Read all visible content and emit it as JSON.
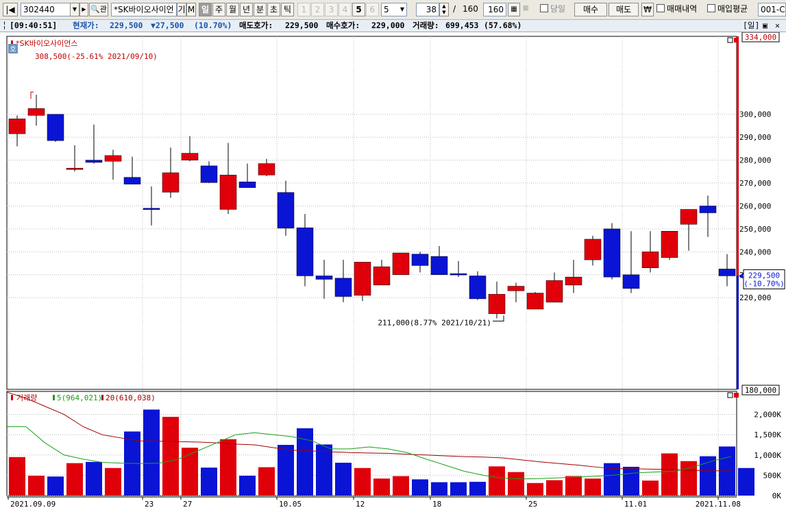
{
  "toolbar": {
    "code": "302440",
    "name": "*SK바이오사이언",
    "gi": "기",
    "m": "M",
    "periods": [
      "일",
      "주",
      "월",
      "년",
      "분",
      "초",
      "틱"
    ],
    "active_period": "일",
    "nums": [
      "1",
      "2",
      "3",
      "4",
      "5",
      "6"
    ],
    "num_select": "5",
    "count": "38",
    "total_sep": "/",
    "total": "160",
    "view": "160",
    "today_label": "당일",
    "buy": "매수",
    "sell": "매도",
    "won": "₩",
    "trade_history": "매매내역",
    "avg_price": "매입평균",
    "account": "001-C"
  },
  "info": {
    "time": "[09:40:51]",
    "cur_label": "현재가:",
    "cur": "229,500",
    "change": "▼27,500",
    "change_pct": "(10.70%)",
    "ask_label": "매도호가:",
    "ask": "229,500",
    "bid_label": "매수호가:",
    "bid": "229,000",
    "vol_label": "거래량:",
    "vol": "699,453",
    "vol_pct": "(57.68%)",
    "mode": "[일]"
  },
  "colors": {
    "up": "#e0000a",
    "down": "#0a14d4",
    "ma5": "#18a018",
    "ma20": "#a00000",
    "grid": "#b8b8b8",
    "text": "#000000",
    "label_red": "#c00000"
  },
  "chart_data": [
    {
      "type": "candlestick",
      "title": "*SK바이오사이언스",
      "ylim": [
        180000,
        334000
      ],
      "ytick_labels": [
        "300,000",
        "290,000",
        "280,000",
        "270,000",
        "260,000",
        "250,000",
        "240,000",
        "230,000",
        "220,000"
      ],
      "ytick_values": [
        300000,
        290000,
        280000,
        270000,
        260000,
        250000,
        240000,
        230000,
        220000
      ],
      "y_top_label": "334,000",
      "y_bottom_label": "180,000",
      "x_labels": [
        "2021.09.09",
        "23",
        "27",
        "10.05",
        "12",
        "18",
        "25",
        "11.01",
        "2021.11.08"
      ],
      "x_label_index": [
        0,
        7,
        9,
        14,
        18,
        22,
        27,
        32,
        37
      ],
      "dates": [
        "09.09",
        "09.10",
        "09.13",
        "09.14",
        "09.15",
        "09.16",
        "09.17",
        "09.23",
        "09.24",
        "09.27",
        "09.28",
        "09.29",
        "09.30",
        "10.01",
        "10.05",
        "10.06",
        "10.07",
        "10.08",
        "10.12",
        "10.13",
        "10.14",
        "10.15",
        "10.18",
        "10.19",
        "10.20",
        "10.21",
        "10.22",
        "10.25",
        "10.26",
        "10.27",
        "10.28",
        "10.29",
        "11.01",
        "11.02",
        "11.03",
        "11.04",
        "11.05",
        "11.08"
      ],
      "open": [
        291500,
        299500,
        300000,
        276500,
        280000,
        279500,
        272500,
        259000,
        266000,
        280000,
        277500,
        258500,
        270500,
        273500,
        265900,
        250500,
        229500,
        228500,
        221000,
        225500,
        230000,
        239000,
        238000,
        230500,
        229500,
        213000,
        223000,
        215000,
        218000,
        225500,
        236500,
        250000,
        230000,
        233000,
        237500,
        252000,
        260000,
        232500
      ],
      "high": [
        299500,
        308500,
        300000,
        286500,
        295500,
        284500,
        281500,
        268500,
        285500,
        290500,
        279500,
        287500,
        278500,
        280500,
        271000,
        256500,
        236500,
        236500,
        230000,
        236500,
        239000,
        240000,
        242500,
        236000,
        231500,
        227000,
        226500,
        222500,
        231000,
        236500,
        247000,
        252500,
        249000,
        249000,
        249000,
        258500,
        264500,
        239000
      ],
      "low": [
        286000,
        295000,
        288000,
        275000,
        278500,
        271500,
        271000,
        251500,
        263500,
        279500,
        270000,
        256500,
        268000,
        273000,
        247000,
        225000,
        219500,
        218000,
        218500,
        227500,
        230000,
        231000,
        234000,
        229000,
        219000,
        211000,
        218000,
        218000,
        218500,
        222000,
        234000,
        228000,
        222000,
        231000,
        236500,
        240500,
        246500,
        225000
      ],
      "close": [
        298000,
        302500,
        288500,
        276500,
        279000,
        282000,
        269500,
        258500,
        274500,
        283000,
        270200,
        273500,
        268000,
        278500,
        250300,
        229500,
        228000,
        220500,
        235500,
        233500,
        239500,
        234000,
        230000,
        230000,
        219500,
        221500,
        225000,
        222000,
        227500,
        229000,
        245500,
        229000,
        224000,
        240000,
        249000,
        258500,
        257000,
        229500
      ],
      "annotations": [
        {
          "text": "308,500(-25.61% 2021/09/10)",
          "index": 1,
          "value": 308500
        },
        {
          "text": "211,000(8.77% 2021/10/21)",
          "index": 25,
          "value": 211000
        }
      ],
      "last_price_label": "229,500",
      "last_change_label": "(-10.70%)",
      "corner_label": "호"
    },
    {
      "type": "bar",
      "title": "거래량",
      "ma5_label": "5(964,021)",
      "ma20_label": "20(610,038)",
      "ylim": [
        0,
        2500000
      ],
      "ytick_labels": [
        "2,000K",
        "1,500K",
        "1,000K",
        "500K",
        "0K"
      ],
      "ytick_values": [
        2000000,
        1500000,
        1000000,
        500000,
        0
      ],
      "volumes": [
        950000,
        490000,
        470000,
        800000,
        830000,
        680000,
        1580000,
        2120000,
        1940000,
        1180000,
        690000,
        1390000,
        490000,
        700000,
        1250000,
        1660000,
        1260000,
        810000,
        680000,
        420000,
        480000,
        400000,
        330000,
        330000,
        340000,
        720000,
        580000,
        310000,
        380000,
        480000,
        420000,
        800000,
        710000,
        370000,
        1040000,
        850000,
        970000,
        1210000,
        680000
      ],
      "ma5": [
        1700000,
        1700000,
        1300000,
        1000000,
        900000,
        820000,
        800000,
        790000,
        800000,
        900000,
        1100000,
        1300000,
        1500000,
        1550000,
        1500000,
        1450000,
        1350000,
        1150000,
        1150000,
        1200000,
        1150000,
        1060000,
        900000,
        750000,
        600000,
        500000,
        430000,
        410000,
        420000,
        440000,
        460000,
        480000,
        510000,
        560000,
        580000,
        600000,
        700000,
        850000,
        964000
      ],
      "ma20": [
        2550000,
        2400000,
        2200000,
        2000000,
        1700000,
        1500000,
        1420000,
        1350000,
        1340000,
        1330000,
        1320000,
        1300000,
        1270000,
        1250000,
        1180000,
        1120000,
        1100000,
        1080000,
        1060000,
        1050000,
        1040000,
        1020000,
        1000000,
        980000,
        960000,
        950000,
        930000,
        880000,
        830000,
        790000,
        750000,
        700000,
        660000,
        660000,
        650000,
        640000,
        620000,
        610000,
        610038
      ]
    }
  ]
}
